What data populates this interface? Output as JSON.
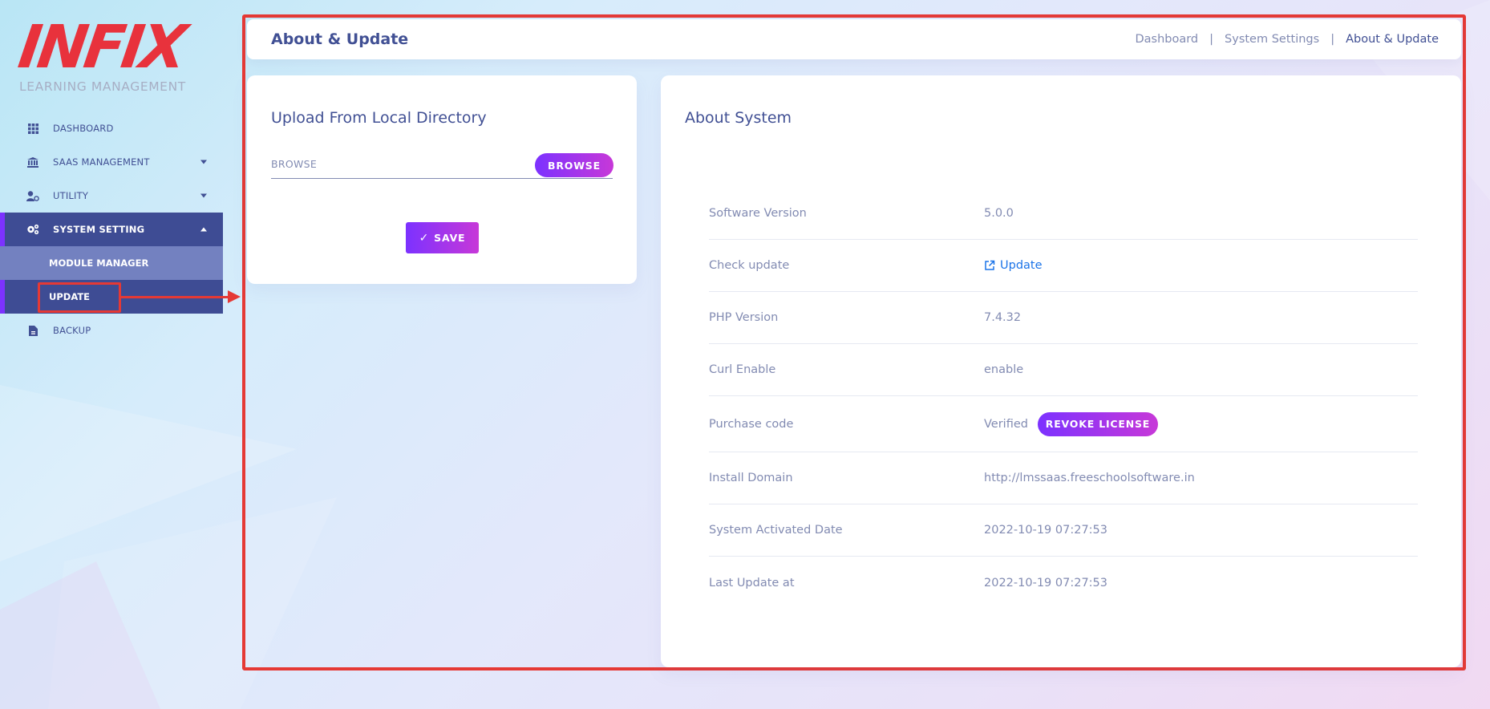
{
  "sidebar": {
    "logo_text": "INFIX",
    "logo_subtitle": "LEARNING MANAGEMENT",
    "items": [
      {
        "label": "DASHBOARD",
        "icon": "grid-icon"
      },
      {
        "label": "SAAS MANAGEMENT",
        "icon": "bank-icon"
      },
      {
        "label": "UTILITY",
        "icon": "user-gear-icon"
      },
      {
        "label": "SYSTEM SETTING",
        "icon": "gears-icon"
      },
      {
        "label": "MODULE MANAGER"
      },
      {
        "label": "UPDATE"
      },
      {
        "label": "BACKUP",
        "icon": "file-icon"
      }
    ]
  },
  "header": {
    "title": "About & Update",
    "breadcrumb": [
      "Dashboard",
      "System Settings",
      "About & Update"
    ],
    "separator": "|"
  },
  "upload": {
    "title": "Upload From Local Directory",
    "browse_placeholder": "BROWSE",
    "browse_button": "BROWSE",
    "save_button": "SAVE"
  },
  "about": {
    "title": "About System",
    "rows": [
      {
        "label": "Software Version",
        "value": "5.0.0"
      },
      {
        "label": "Check update",
        "value": "Update"
      },
      {
        "label": "PHP Version",
        "value": "7.4.32"
      },
      {
        "label": "Curl Enable",
        "value": "enable"
      },
      {
        "label": "Purchase code",
        "value": "Verified",
        "button": "REVOKE LICENSE"
      },
      {
        "label": "Install Domain",
        "value": "http://lmssaas.freeschoolsoftware.in"
      },
      {
        "label": "System Activated Date",
        "value": "2022-10-19 07:27:53"
      },
      {
        "label": "Last Update at",
        "value": "2022-10-19 07:27:53"
      }
    ]
  },
  "colors": {
    "primary_text": "#415094",
    "muted_text": "#828bb2",
    "accent_purple": "#7c32ff",
    "accent_pink": "#c738d8",
    "annotation_red": "#e53935",
    "logo_red": "#e8323c",
    "link_blue": "#1a73e8"
  }
}
